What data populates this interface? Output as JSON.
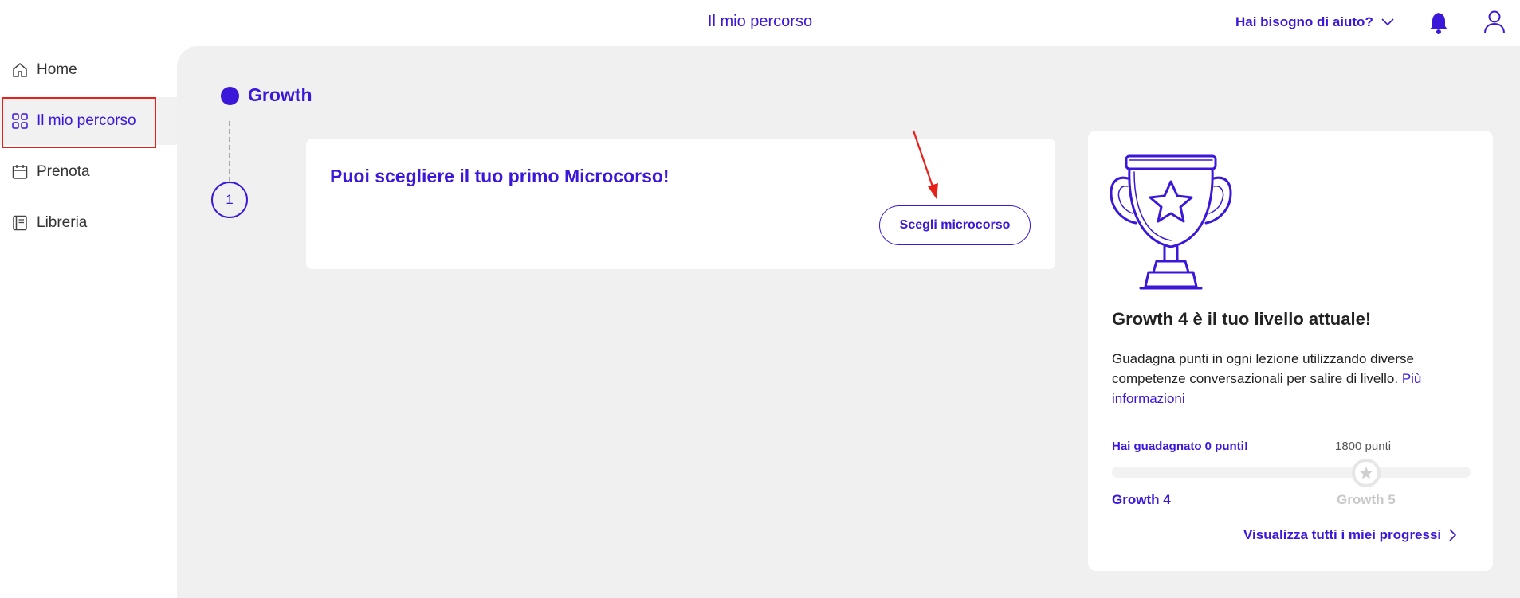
{
  "header": {
    "title": "Il mio percorso",
    "help_label": "Hai bisogno di aiuto?"
  },
  "sidebar": {
    "items": [
      {
        "label": "Home",
        "icon": "home-icon"
      },
      {
        "label": "Il mio percorso",
        "icon": "grid-icon",
        "active": true
      },
      {
        "label": "Prenota",
        "icon": "calendar-icon"
      },
      {
        "label": "Libreria",
        "icon": "book-icon"
      }
    ]
  },
  "path": {
    "level_name": "Growth",
    "step_number": "1"
  },
  "microcourse_card": {
    "title": "Puoi scegliere il tuo primo Microcorso!",
    "button_label": "Scegli microcorso"
  },
  "level_card": {
    "title": "Growth 4 è il tuo livello attuale!",
    "description": "Guadagna punti in ogni lezione utilizzando diverse competenze conversazionali per salire di livello.",
    "more_link": "Più informazioni",
    "points_earned_label": "Hai guadagnato 0 punti!",
    "points_target_label": "1800 punti",
    "progress_fraction": 0,
    "current_level": "Growth 4",
    "next_level": "Growth 5",
    "progress_link": "Visualizza tutti i miei progressi"
  },
  "colors": {
    "accent": "#3a17d9",
    "annotation": "#e8201a",
    "background": "#f0f0f0"
  }
}
